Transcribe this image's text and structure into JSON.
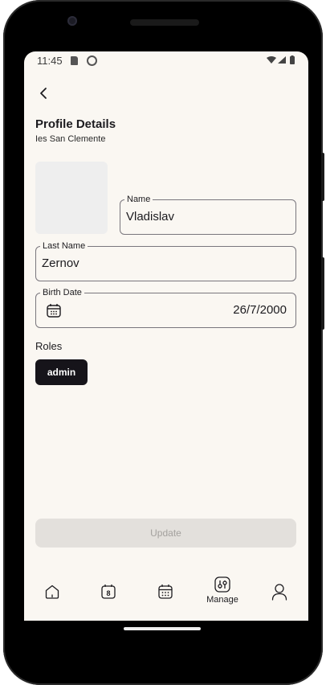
{
  "status_bar": {
    "time": "11:45"
  },
  "header": {
    "title": "Profile Details",
    "subtitle": "Ies San Clemente"
  },
  "form": {
    "name": {
      "label": "Name",
      "value": "Vladislav"
    },
    "last_name": {
      "label": "Last Name",
      "value": "Zernov"
    },
    "birth_date": {
      "label": "Birth Date",
      "value": "26/7/2000"
    }
  },
  "roles": {
    "label": "Roles",
    "items": [
      "admin"
    ]
  },
  "update_button": {
    "label": "Update",
    "enabled": false
  },
  "bottom_nav": {
    "items": [
      {
        "icon": "home-icon"
      },
      {
        "icon": "calendar-day-icon",
        "badge": "8"
      },
      {
        "icon": "calendar-icon"
      },
      {
        "icon": "sliders-icon",
        "label": "Manage",
        "active": true
      },
      {
        "icon": "person-icon"
      }
    ]
  }
}
